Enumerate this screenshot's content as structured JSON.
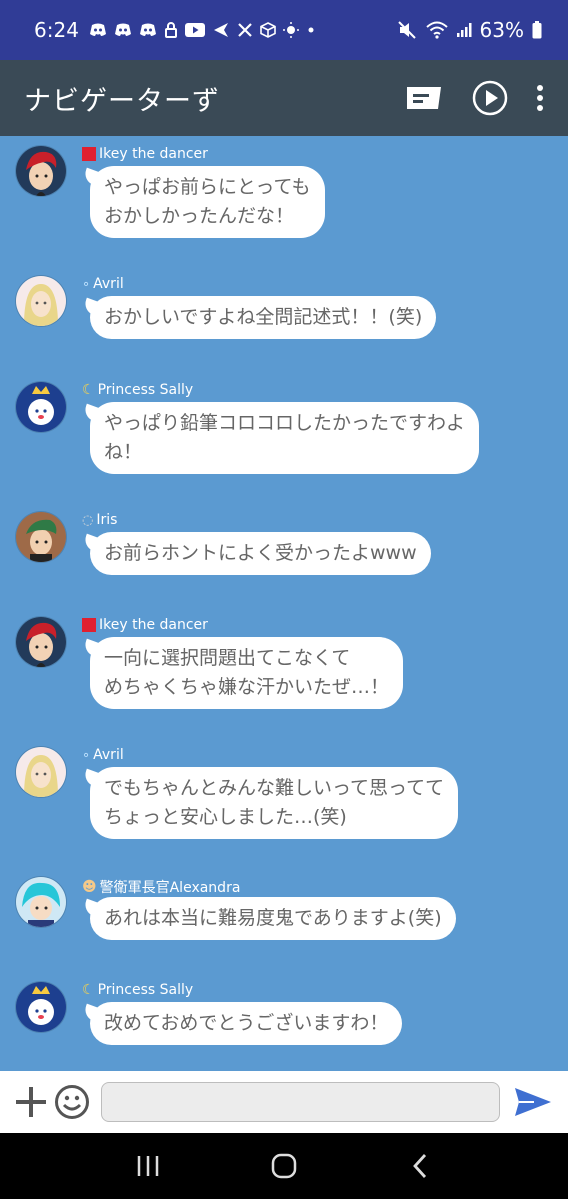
{
  "status_bar": {
    "time": "6:24",
    "battery": "63%"
  },
  "app_bar": {
    "title": "ナビゲーターず"
  },
  "messages": [
    {
      "sender": "Ikey the dancer",
      "text_lines": [
        "やっぱお前らにとっても",
        "おかしかったんだな！"
      ],
      "avatar": "red-hair-boy"
    },
    {
      "sender": "Avril",
      "text_lines": [
        "おかしいですよね全問記述式！！(笑)"
      ],
      "avatar": "blonde-girl"
    },
    {
      "sender": "Princess Sally",
      "text_lines": [
        "やっぱり鉛筆コロコロしたかったですわよ",
        "ね！"
      ],
      "avatar": "princess-crown"
    },
    {
      "sender": "Iris",
      "text_lines": [
        "お前らホントによく受かったよwww"
      ],
      "avatar": "green-hair-girl"
    },
    {
      "sender": "Ikey the dancer",
      "text_lines": [
        "一向に選択問題出てこなくて",
        "めちゃくちゃ嫌な汗かいたぜ…！"
      ],
      "avatar": "red-hair-boy"
    },
    {
      "sender": "Avril",
      "text_lines": [
        "でもちゃんとみんな難しいって思ってて",
        "ちょっと安心しました…(笑)"
      ],
      "avatar": "blonde-girl"
    },
    {
      "sender": "警衛軍長官Alexandra",
      "text_lines": [
        "あれは本当に難易度鬼でありますよ(笑)"
      ],
      "avatar": "cyan-hair-officer"
    },
    {
      "sender": "Princess Sally",
      "text_lines": [
        "改めておめでとうございますわ！"
      ],
      "avatar": "princess-crown"
    }
  ],
  "input": {
    "placeholder": ""
  },
  "colors": {
    "status_bar": "#303c96",
    "app_bar": "#3a4a56",
    "chat_background": "#5b9ad1",
    "send_icon": "#3f6fd1"
  }
}
